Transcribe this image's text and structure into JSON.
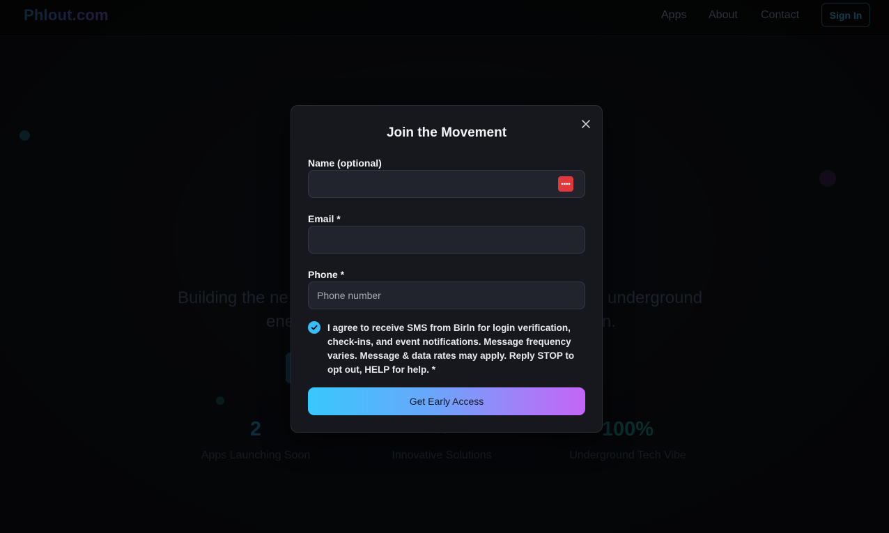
{
  "site": {
    "logo": "Phlout.com",
    "nav": {
      "apps": "Apps",
      "about": "About",
      "contact": "Contact",
      "signin": "Sign In"
    }
  },
  "hero": {
    "line1_left": "Building the ne",
    "line1_right": "underground",
    "line2_left": "ene",
    "line2_right": "n."
  },
  "stats": [
    {
      "value": "2",
      "label": "Apps Launching Soon"
    },
    {
      "value": "∞",
      "label": "Innovative Solutions"
    },
    {
      "value": "100%",
      "label": "Underground Tech Vibe"
    }
  ],
  "modal": {
    "title": "Join the Movement",
    "name_label": "Name (optional)",
    "name_value": "",
    "email_label": "Email *",
    "email_value": "",
    "phone_label": "Phone *",
    "phone_placeholder": "Phone number",
    "consent_checked": true,
    "consent_text": "I agree to receive SMS from Birln for login verification, check-ins, and event notifications. Message frequency varies. Message & data rates may apply. Reply STOP to opt out, HELP for help. *",
    "submit_label": "Get Early Access"
  },
  "colors": {
    "accent_cyan": "#38c8fd",
    "accent_purple": "#c564f7",
    "modal_bg": "#17181d",
    "input_bg": "#22242d",
    "password_manager_icon": "#e0393b"
  }
}
